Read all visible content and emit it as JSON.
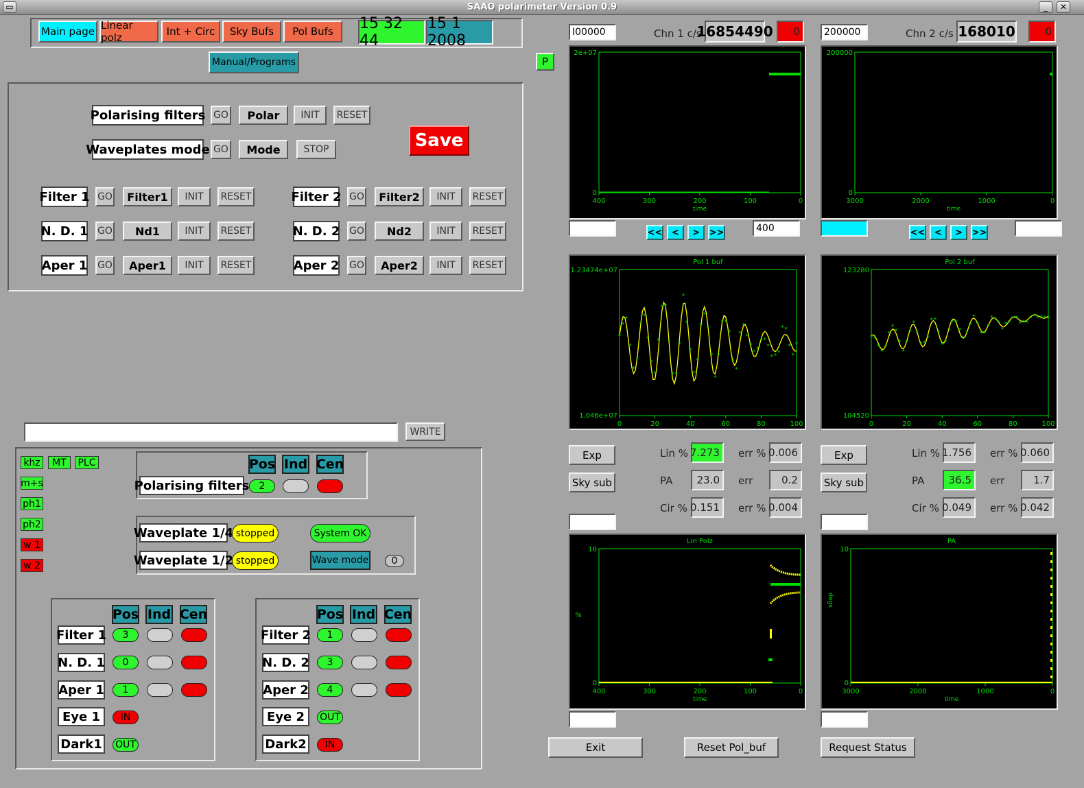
{
  "window": {
    "title": "SAAO polarimeter Version 0.9"
  },
  "nav": {
    "main": "Main page",
    "linear": "Linear polz",
    "intcirc": "Int + Circ",
    "skybufs": "Sky Bufs",
    "polbufs": "Pol Bufs",
    "time": "15 32 44",
    "date": "15 1 2008",
    "manual": "Manual/Programs",
    "p": "P"
  },
  "controls": {
    "go": "GO",
    "init": "INIT",
    "reset": "RESET",
    "stop": "STOP",
    "save": "Save",
    "polfilt": "Polarising filters",
    "polar": "Polar",
    "wavemode": "Waveplates mode",
    "mode": "Mode",
    "f1": "Filter 1",
    "f1b": "Filter1",
    "f2": "Filter 2",
    "f2b": "Filter2",
    "nd1": "N. D. 1",
    "nd1b": "Nd1",
    "nd2": "N. D. 2",
    "nd2b": "Nd2",
    "ap1": "Aper 1",
    "ap1b": "Aper1",
    "ap2": "Aper 2",
    "ap2b": "Aper2"
  },
  "write": {
    "label": "WRITE",
    "value": ""
  },
  "leds": [
    "khz",
    "MT",
    "PLC",
    "m+s",
    "ph1",
    "ph2",
    "w 1",
    "w 2"
  ],
  "status": {
    "pos": "Pos",
    "ind": "Ind",
    "cen": "Cen",
    "polfilt": "Polarising filters",
    "polpos": "2",
    "wp4": "Waveplate 1/4",
    "wp2": "Waveplate 1/2",
    "stopped": "stopped",
    "sysok": "System OK",
    "wavemode": "Wave mode",
    "wavecount": "0",
    "f1": "Filter 1",
    "f1pos": "3",
    "nd1": "N. D. 1",
    "nd1pos": "0",
    "ap1": "Aper 1",
    "ap1pos": "1",
    "eye1": "Eye 1",
    "eye1v": "IN",
    "dark1": "Dark1",
    "dark1v": "OUT",
    "f2": "Filter 2",
    "f2pos": "1",
    "nd2": "N. D. 2",
    "nd2pos": "3",
    "ap2": "Aper 2",
    "ap2pos": "4",
    "eye2": "Eye 2",
    "eye2v": "OUT",
    "dark2": "Dark2",
    "dark2v": "IN"
  },
  "chan1": {
    "scale": "I00000",
    "label": "Chn 1 c/s",
    "count": "16854490",
    "err": "0",
    "lin": "7.273",
    "linerr": "0.006",
    "pa": "23.0",
    "paerr": "0.2",
    "cir": "0.151",
    "cirerr": "0.004",
    "range": "400"
  },
  "chan2": {
    "scale": "200000",
    "label": "Chn 2 c/s",
    "count": "168010",
    "err": "0",
    "lin": "1.756",
    "linerr": "0.060",
    "pa": "36.5",
    "paerr": "1.7",
    "cir": "0.049",
    "cirerr": "0.042",
    "range": ""
  },
  "labels": {
    "lin": "Lin %",
    "err": "err",
    "errp": "err %",
    "pa": "PA",
    "cir": "Cir %",
    "exp": "Exp",
    "skysub": "Sky sub",
    "exit": "Exit",
    "resetpol": "Reset Pol_buf",
    "reqstat": "Request Status",
    "first": "<<",
    "prev": "<",
    "next": ">",
    "last": ">>"
  },
  "plots": {
    "c1": {
      "ymax": "2e+07",
      "ymin": "0",
      "xt": [
        "400",
        "300",
        "200",
        "100",
        "0"
      ],
      "xlabel": "time"
    },
    "c2": {
      "ymax": "200000",
      "ymin": "0",
      "xt": [
        "3000",
        "2000",
        "1000",
        "0"
      ],
      "xlabel": "time"
    },
    "p1": {
      "title": "Pol 1 buf",
      "ymax": "1.23474e+07",
      "ymin": "1.046e+07",
      "xt": [
        "0",
        "20",
        "40",
        "60",
        "80",
        "100"
      ]
    },
    "p2": {
      "title": "Pol 2 buf",
      "ymax": "123280",
      "ymin": "104520",
      "xt": [
        "0",
        "20",
        "40",
        "60",
        "80",
        "100"
      ]
    },
    "lp": {
      "title": "Lin Polz",
      "ymax": "10",
      "ymin": "0",
      "ylabel": "%",
      "xt": [
        "400",
        "300",
        "200",
        "100",
        "0"
      ],
      "xlabel": "time"
    },
    "pa": {
      "title": "PA",
      "ymax": "10",
      "ymin": "0",
      "ylabel": "degs",
      "xt": [
        "3000",
        "2000",
        "1000",
        "0"
      ],
      "xlabel": "time"
    }
  },
  "colors": {
    "green": "#2ef52e",
    "red": "#f00000",
    "teal": "#299ba6",
    "cyan": "#00f0ff",
    "salmon": "#f06a4a",
    "yellow": "#ffff00",
    "plotgreen": "#00e000"
  }
}
